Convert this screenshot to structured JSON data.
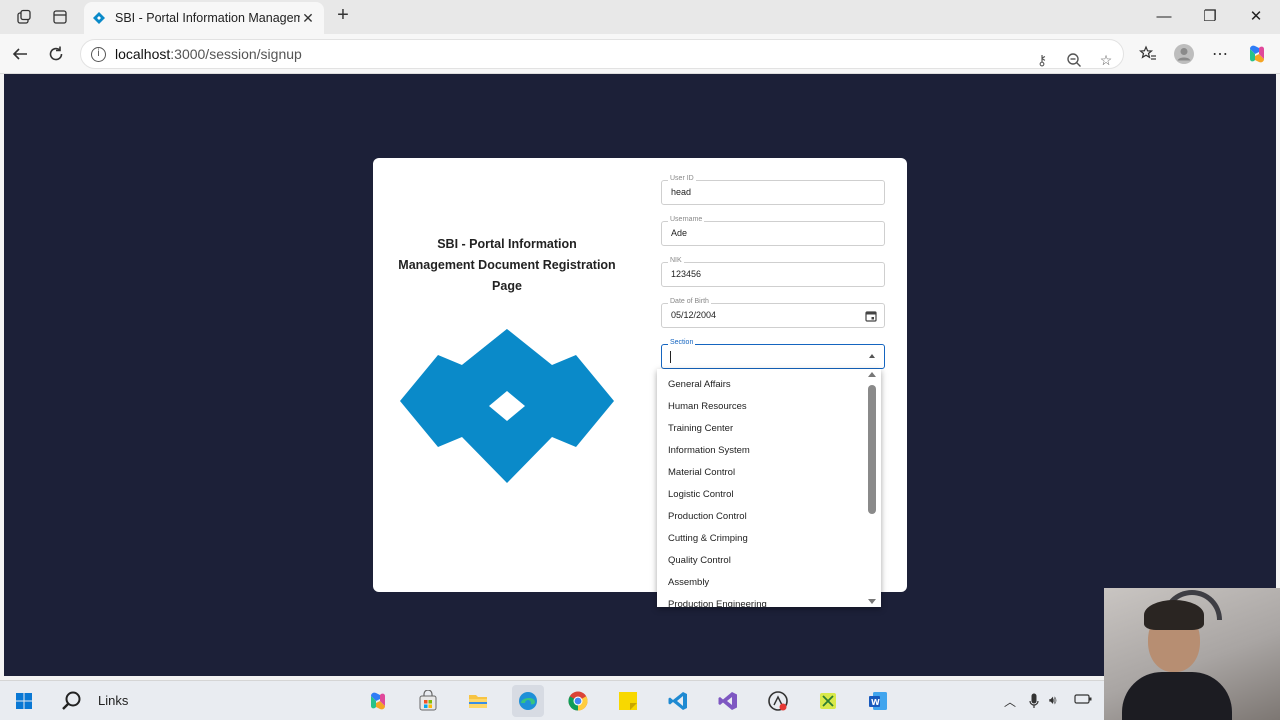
{
  "browser": {
    "tab_title": "SBI - Portal Information Management Document Registration Page",
    "url_host": "localhost",
    "url_path": ":3000/session/signup"
  },
  "page": {
    "title_line1": "SBI - Portal Information",
    "title_line2": "Management Document Registration",
    "title_line3": "Page",
    "logo_color": "#0a8ac9",
    "background_color": "#1c2038"
  },
  "form": {
    "user_id": {
      "label": "User ID",
      "value": "head"
    },
    "username": {
      "label": "Username",
      "value": "Ade"
    },
    "nik": {
      "label": "NIK",
      "value": "123456"
    },
    "date_of_birth": {
      "label": "Date of Birth",
      "value": "05/12/2004"
    },
    "section": {
      "label": "Section",
      "value": ""
    }
  },
  "section_options": [
    "General Affairs",
    "Human Resources",
    "Training Center",
    "Information System",
    "Material Control",
    "Logistic Control",
    "Production Control",
    "Cutting & Crimping",
    "Quality Control",
    "Assembly",
    "Production Engineering"
  ],
  "taskbar": {
    "search_label": "Links"
  }
}
